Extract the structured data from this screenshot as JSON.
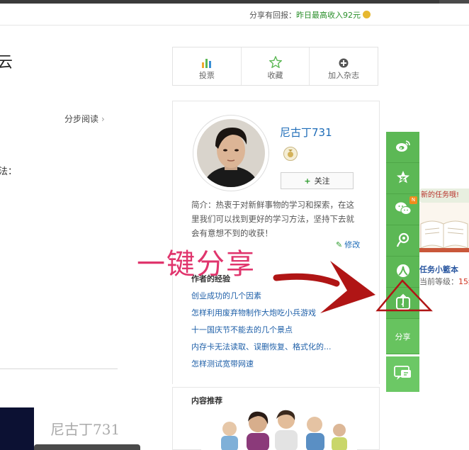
{
  "header": {
    "reward_label": "分享有回报：",
    "reward_value": "昨日最高收入92元"
  },
  "left": {
    "title_fragment": "云",
    "step_read": "分步阅读",
    "method_fragment": "法：",
    "bottom_author": "尼古丁731"
  },
  "actions": [
    {
      "label": "投票",
      "icon": "bar-chart-icon"
    },
    {
      "label": "收藏",
      "icon": "star-icon"
    },
    {
      "label": "加入杂志",
      "icon": "plus-circle-icon"
    }
  ],
  "author": {
    "name": "尼古丁731",
    "follow_label": "关注",
    "bio": "简介：热衷于对新鲜事物的学习和探索，在这里我们可以找到更好的学习方法，坚持下去就会有意想不到的收获！",
    "edit_label": "修改",
    "experience_title": "作者的经验",
    "experiences": [
      "创业成功的几个因素",
      "怎样利用废弃物制作大炮吃小兵游戏",
      "十一国庆节不能去的几个景点",
      "内存卡无法读取、误删恢复、格式化的...",
      "怎样测试宽带网速"
    ]
  },
  "recommend": {
    "title": "内容推荐"
  },
  "share_rail": {
    "buttons": [
      "weibo-icon",
      "qzone-icon",
      "wechat-icon",
      "tencent-weibo-icon",
      "renren-icon",
      "one-key-share-icon"
    ],
    "share_label": "分享",
    "badge": "N",
    "accent": "#5cb855"
  },
  "promo": {
    "banner": "新的任务哦!",
    "title": "任务小籃本",
    "level_label": "当前等级：",
    "level_value": "15级"
  },
  "annotation": {
    "text": "一键分享",
    "color": "#e0356d",
    "arrow_color": "#b01515"
  }
}
